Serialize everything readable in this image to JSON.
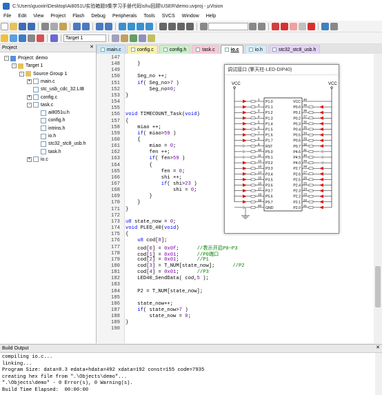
{
  "window": {
    "title": "C:\\Users\\guoxin\\Desktop\\Ai8051U实验箱题9集学习手册代码\\shu回顾\\USER\\demo.uvproj - µVision"
  },
  "menu": [
    "File",
    "Edit",
    "View",
    "Project",
    "Flash",
    "Debug",
    "Peripherals",
    "Tools",
    "SVCS",
    "Window",
    "Help"
  ],
  "target": "Target 1",
  "project_pane": {
    "title": "Project",
    "close": "✕",
    "tree": [
      {
        "label": "Project: demo",
        "level": 0,
        "kind": "proj",
        "exp": "-"
      },
      {
        "label": "Target 1",
        "level": 1,
        "kind": "folder",
        "exp": "-"
      },
      {
        "label": "Source Group 1",
        "level": 2,
        "kind": "folder",
        "exp": "-"
      },
      {
        "label": "main.c",
        "level": 3,
        "kind": "file",
        "exp": "+"
      },
      {
        "label": "stc_usb_cdc_32.LIB",
        "level": 3,
        "kind": "file",
        "exp": ""
      },
      {
        "label": "config.c",
        "level": 3,
        "kind": "file",
        "exp": "+"
      },
      {
        "label": "task.c",
        "level": 3,
        "kind": "file",
        "exp": "-"
      },
      {
        "label": "ai8051u.h",
        "level": 4,
        "kind": "file",
        "exp": ""
      },
      {
        "label": "config.h",
        "level": 4,
        "kind": "file",
        "exp": ""
      },
      {
        "label": "intrins.h",
        "level": 4,
        "kind": "file",
        "exp": ""
      },
      {
        "label": "io.h",
        "level": 4,
        "kind": "file",
        "exp": ""
      },
      {
        "label": "stc32_stc8_usb.h",
        "level": 4,
        "kind": "file",
        "exp": ""
      },
      {
        "label": "task.h",
        "level": 4,
        "kind": "file",
        "exp": ""
      },
      {
        "label": "io.c",
        "level": 3,
        "kind": "file",
        "exp": "+"
      }
    ],
    "bottom_tabs": [
      "Project",
      "Books",
      "{} Func...",
      "0. Temp..."
    ]
  },
  "tabs": [
    {
      "label": "main.c",
      "color": "#c9e6f7",
      "active": false
    },
    {
      "label": "config.c",
      "color": "#f7f1b0",
      "active": false
    },
    {
      "label": "config.h",
      "color": "#c9f0c9",
      "active": false
    },
    {
      "label": "task.c",
      "color": "#f7c9d8",
      "active": false
    },
    {
      "label": "io.c",
      "color": "#ffffff",
      "active": true
    },
    {
      "label": "io.h",
      "color": "#d4ecfb",
      "active": false
    },
    {
      "label": "stc32_stc8_usb.h",
      "color": "#e3d3f5",
      "active": false
    }
  ],
  "code": [
    {
      "n": "147",
      "t": ""
    },
    {
      "n": "148",
      "t": "    }"
    },
    {
      "n": "149",
      "t": ""
    },
    {
      "n": "150",
      "t": "    Seg_no ++;"
    },
    {
      "n": "151",
      "t": "    if( Seg_no>7 )"
    },
    {
      "n": "152",
      "t": "        Seg_no=0;"
    },
    {
      "n": "153",
      "t": "}"
    },
    {
      "n": "154",
      "t": ""
    },
    {
      "n": "155",
      "t": ""
    },
    {
      "n": "156",
      "t": "void TIMECOUNT_Task(void)"
    },
    {
      "n": "157",
      "t": "{"
    },
    {
      "n": "158",
      "t": "    miao ++;"
    },
    {
      "n": "159",
      "t": "    if( miao>59 )"
    },
    {
      "n": "160",
      "t": "    {"
    },
    {
      "n": "161",
      "t": "        miao = 0;"
    },
    {
      "n": "162",
      "t": "        fen ++;"
    },
    {
      "n": "163",
      "t": "        if( fen>59 )"
    },
    {
      "n": "164",
      "t": "        {"
    },
    {
      "n": "165",
      "t": "            fen = 0;"
    },
    {
      "n": "166",
      "t": "            shi ++;"
    },
    {
      "n": "167",
      "t": "            if( shi>23 )"
    },
    {
      "n": "168",
      "t": "                shi = 0;"
    },
    {
      "n": "169",
      "t": "        }"
    },
    {
      "n": "170",
      "t": "    }"
    },
    {
      "n": "171",
      "t": "}"
    },
    {
      "n": "172",
      "t": ""
    },
    {
      "n": "173",
      "t": "u8 state_now = 0;"
    },
    {
      "n": "174",
      "t": "void PLED_40(void)"
    },
    {
      "n": "175",
      "t": "{"
    },
    {
      "n": "176",
      "t": "    u8 cod[8];"
    },
    {
      "n": "177",
      "t": "    cod[0] = 0x0f;      //表示开启P0~P3"
    },
    {
      "n": "178",
      "t": "    cod[1] = 0x01;      //P0端口"
    },
    {
      "n": "179",
      "t": "    cod[2] = 0x01;      //P1"
    },
    {
      "n": "180",
      "t": "    cod[3] = T_NUM[state_now];      //P2"
    },
    {
      "n": "181",
      "t": "    cod[4] = 0x01;      //P3"
    },
    {
      "n": "182",
      "t": "    LED40_SendData( cod,5 );"
    },
    {
      "n": "183",
      "t": ""
    },
    {
      "n": "184",
      "t": "    P2 = T_NUM[state_now];"
    },
    {
      "n": "185",
      "t": ""
    },
    {
      "n": "186",
      "t": "    state_now++;"
    },
    {
      "n": "187",
      "t": "    if( state_now>7 )"
    },
    {
      "n": "188",
      "t": "        state_now = 0;"
    },
    {
      "n": "189",
      "t": "}"
    },
    {
      "n": "190",
      "t": ""
    }
  ],
  "debug_window": {
    "title": "调试接口 (擎天柱-LED-DIP40)",
    "vcc": "VCC",
    "left_pins": [
      "P1.0",
      "P1.1",
      "P1.2",
      "P1.3",
      "P1.4",
      "P1.5",
      "P1.6",
      "P1.7",
      "RST",
      "P5.0",
      "P5.1",
      "P3.2",
      "P3.3",
      "P3.4",
      "P3.5",
      "P3.6",
      "P3.7",
      "P5.6",
      "P5.7",
      "GND"
    ],
    "right_pins": [
      "VCC",
      "P0.0",
      "P0.1",
      "P0.2",
      "P0.3",
      "P0.4",
      "P0.5",
      "P0.6",
      "P0.7",
      "P4.6",
      "P4.5",
      "P4.0",
      "P2.7",
      "P2.6",
      "P2.5",
      "P2.4",
      "P2.3",
      "P2.2",
      "P2.1",
      "P2.0"
    ],
    "left_nums": [
      "1",
      "2",
      "3",
      "4",
      "5",
      "6",
      "7",
      "8",
      "9",
      "10",
      "11",
      "12",
      "13",
      "14",
      "15",
      "16",
      "17",
      "18",
      "19",
      "20"
    ],
    "right_nums": [
      "40",
      "39",
      "38",
      "37",
      "36",
      "35",
      "34",
      "33",
      "32",
      "31",
      "30",
      "29",
      "28",
      "27",
      "26",
      "25",
      "24",
      "23",
      "22",
      "21"
    ],
    "left_on": [
      1,
      1,
      1,
      1,
      1,
      1,
      1,
      1,
      0,
      0,
      0,
      1,
      1,
      1,
      1,
      1,
      1,
      1,
      1,
      0
    ],
    "right_on": [
      0,
      1,
      1,
      1,
      1,
      1,
      1,
      1,
      1,
      0,
      0,
      0,
      1,
      1,
      1,
      1,
      1,
      1,
      1,
      1
    ]
  },
  "build": {
    "title": "Build Output",
    "lines": [
      "compiling io.c...",
      "linking...",
      "Program Size: data=8.3 edata+hdata=492 xdata=192 const=155 code=7935",
      "creating hex file from \".\\Objects\\demo\"...",
      "\".\\Objects\\demo\" - 0 Error(s), 0 Warning(s).",
      "Build Time Elapsed:  00:00:00"
    ]
  }
}
